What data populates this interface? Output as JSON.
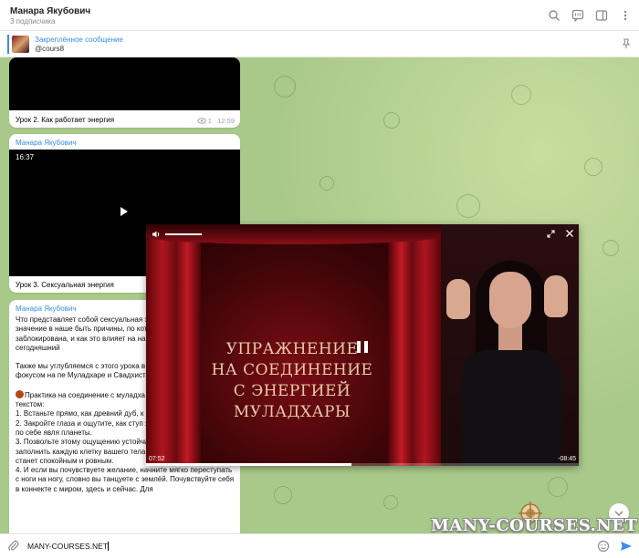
{
  "header": {
    "title": "Манара Якубович",
    "subtitle": "3 подписчика"
  },
  "pinned": {
    "title": "Закреплённое сообщение",
    "text": "@cours8"
  },
  "messages": [
    {
      "caption": "Урок 2. Как работает энергия",
      "views": "1",
      "time": "12:59"
    },
    {
      "sender": "Манара Якубович",
      "duration": "16:37",
      "caption": "Урок 3. Сексуальная энергия"
    },
    {
      "sender": "Манара Якубович",
      "paragraphs": [
        "Что представляет собой сексуальная э имеет такое важное значение в наше быть причины, по которым эта энерги заблокирована, и как это влияет на на радости? - об этом наш сегодняшний",
        "Также мы углубляемся с этого урока в чакральной системы, с фокусом на пе Муладхаре и Свадхистане.",
        "Практика на соединение с муладха для вас упражнение текстом:\n1.  Встаньте прямо, как древний дуб, к глубоко в землю.\n2.  Закройте глаза и ощутите, как ступ земли, словно они сами по себе явля планеты.\n3.  Позвольте этому ощущению устойчивости и прочности заполнить каждую клетку вашего тела, пусть ваше дыхание станет спокойным и ровным.\n4.  И если вы почувствуете желание, начните мягко переступать с ноги на ногу, словно вы танцуете с землёй. Почувствуйте себя в коннекте с миром, здесь и сейчас. Для"
      ]
    }
  ],
  "player": {
    "title_lines": [
      "УПРАЖНЕНИЕ",
      "НА СОЕДИНЕНИЕ",
      "С ЭНЕРГИЕЙ МУЛАДХАРЫ"
    ],
    "current_time": "07:52",
    "remaining_time": "-08:45",
    "progress": 0.475
  },
  "input": {
    "value": "MANY-COURSES.NET"
  },
  "watermark": "MANY-COURSES.NET",
  "colors": {
    "accent": "#3a8ee6",
    "chat_background": "#a9c98b",
    "curtain": "#b01520"
  },
  "icons": [
    "search-icon",
    "comments-icon",
    "sidebar-icon",
    "more-icon",
    "pin-list-icon",
    "views-eye-icon",
    "play-icon",
    "pause-icon",
    "volume-icon",
    "pip-icon",
    "close-icon",
    "scroll-down-icon",
    "attach-icon",
    "emoji-icon",
    "send-icon"
  ]
}
